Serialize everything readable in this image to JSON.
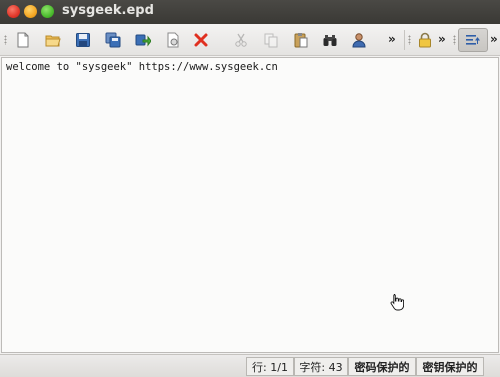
{
  "window": {
    "title": "sysgeek.epd"
  },
  "toolbar": {
    "buttons": [
      {
        "icon": "new-document-icon"
      },
      {
        "icon": "open-folder-icon"
      },
      {
        "icon": "save-icon"
      },
      {
        "icon": "save-all-icon"
      },
      {
        "icon": "save-as-icon"
      },
      {
        "icon": "print-icon"
      },
      {
        "icon": "close-red-x-icon"
      },
      {
        "icon": "cut-icon"
      },
      {
        "icon": "copy-icon"
      },
      {
        "icon": "paste-icon"
      },
      {
        "icon": "binoculars-find-icon"
      },
      {
        "icon": "user-icon"
      },
      {
        "icon": "lock-icon"
      },
      {
        "icon": "format-lines-icon"
      }
    ],
    "overflow_label": "»"
  },
  "editor": {
    "text": "welcome to \"sysgeek\" https://www.sysgeek.cn"
  },
  "status": {
    "line": "行: 1/1",
    "chars": "字符: 43",
    "password_protected": "密码保护的",
    "key_protected": "密钥保护的"
  }
}
